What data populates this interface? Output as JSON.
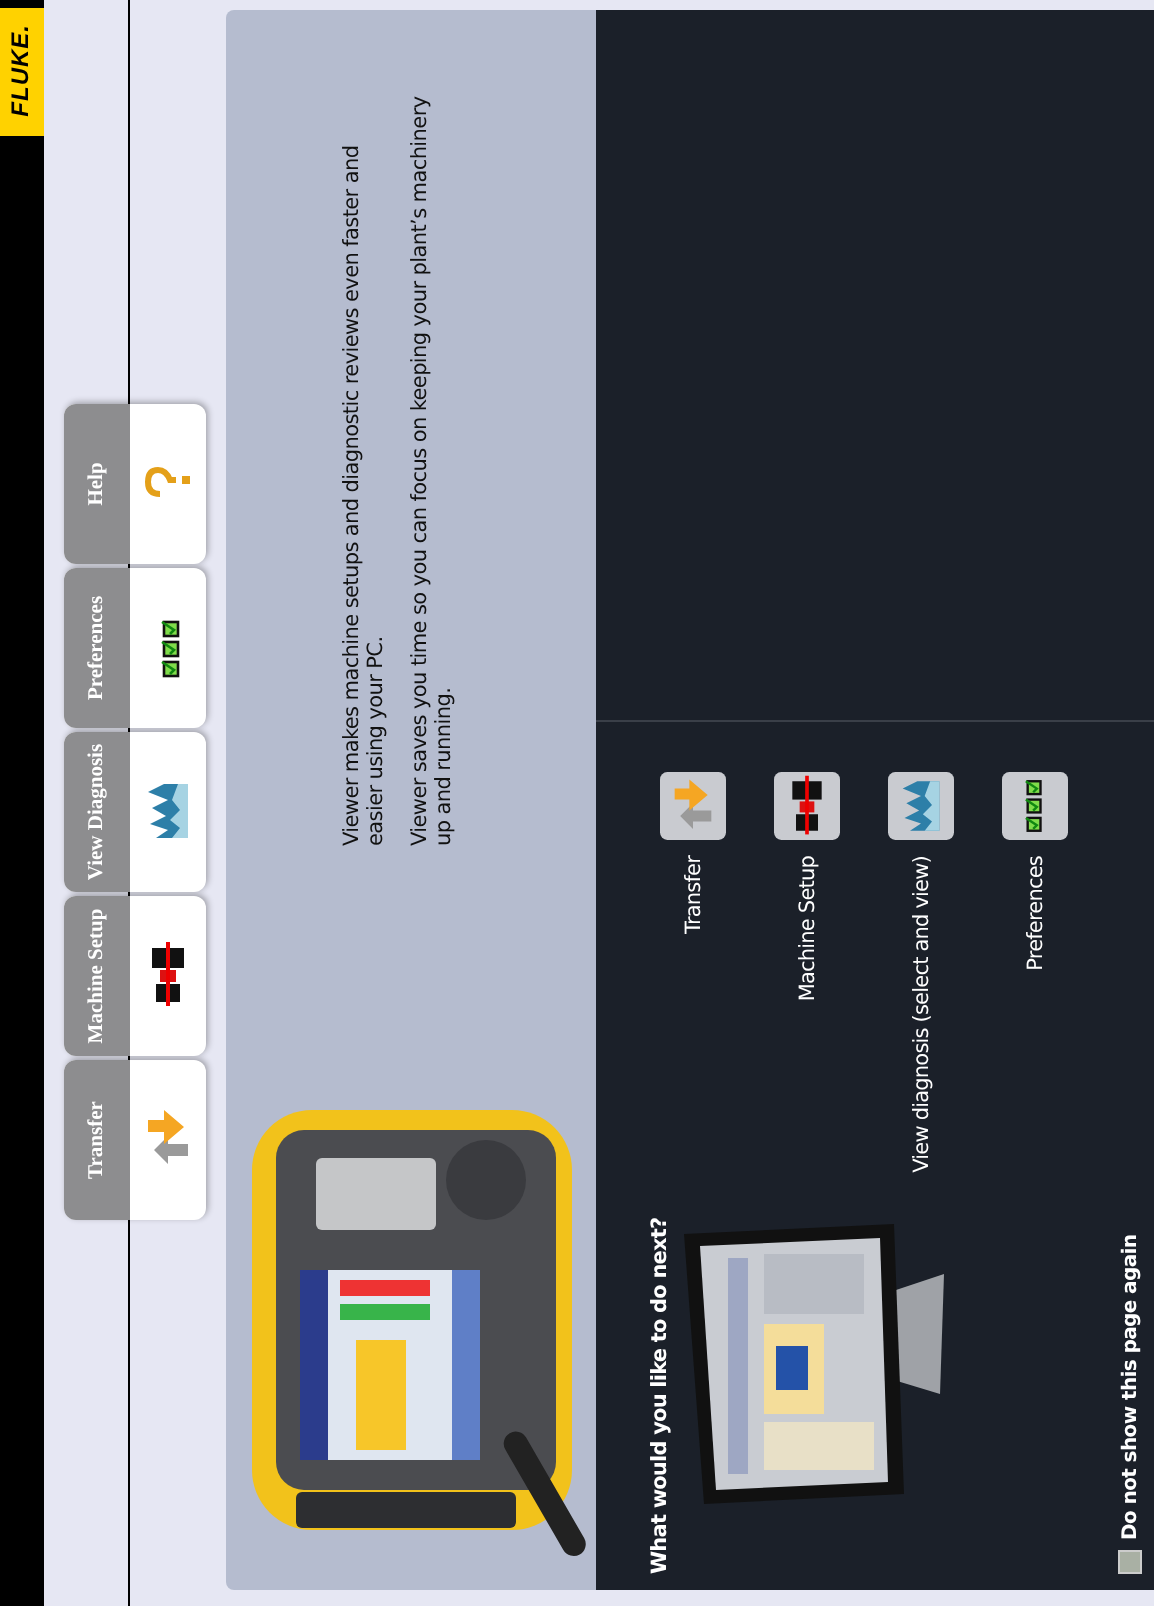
{
  "brand": {
    "logo": "FLUKE."
  },
  "toolbar": {
    "tabs": [
      {
        "label": "Transfer",
        "kind": "transfer"
      },
      {
        "label": "Machine Setup",
        "kind": "setup"
      },
      {
        "label": "View Diagnosis",
        "kind": "diagnosis"
      },
      {
        "label": "Preferences",
        "kind": "preferences"
      },
      {
        "label": "Help",
        "kind": "help"
      }
    ]
  },
  "intro": {
    "paragraphs": [
      "Viewer makes machine setups and diagnostic reviews even faster and easier using  your PC.",
      "Viewer saves  you time so you can focus on keeping  your plant’s machinery up and running."
    ]
  },
  "next": {
    "title": "What would you like to do next?",
    "options": [
      {
        "label": "Transfer",
        "kind": "transfer"
      },
      {
        "label": "Machine Setup",
        "kind": "setup"
      },
      {
        "label": "View diagnosis (select and view)",
        "kind": "diagnosis"
      },
      {
        "label": "Preferences",
        "kind": "preferences"
      }
    ]
  },
  "dont_show": {
    "label": "Do not show this page again",
    "checked": false
  }
}
